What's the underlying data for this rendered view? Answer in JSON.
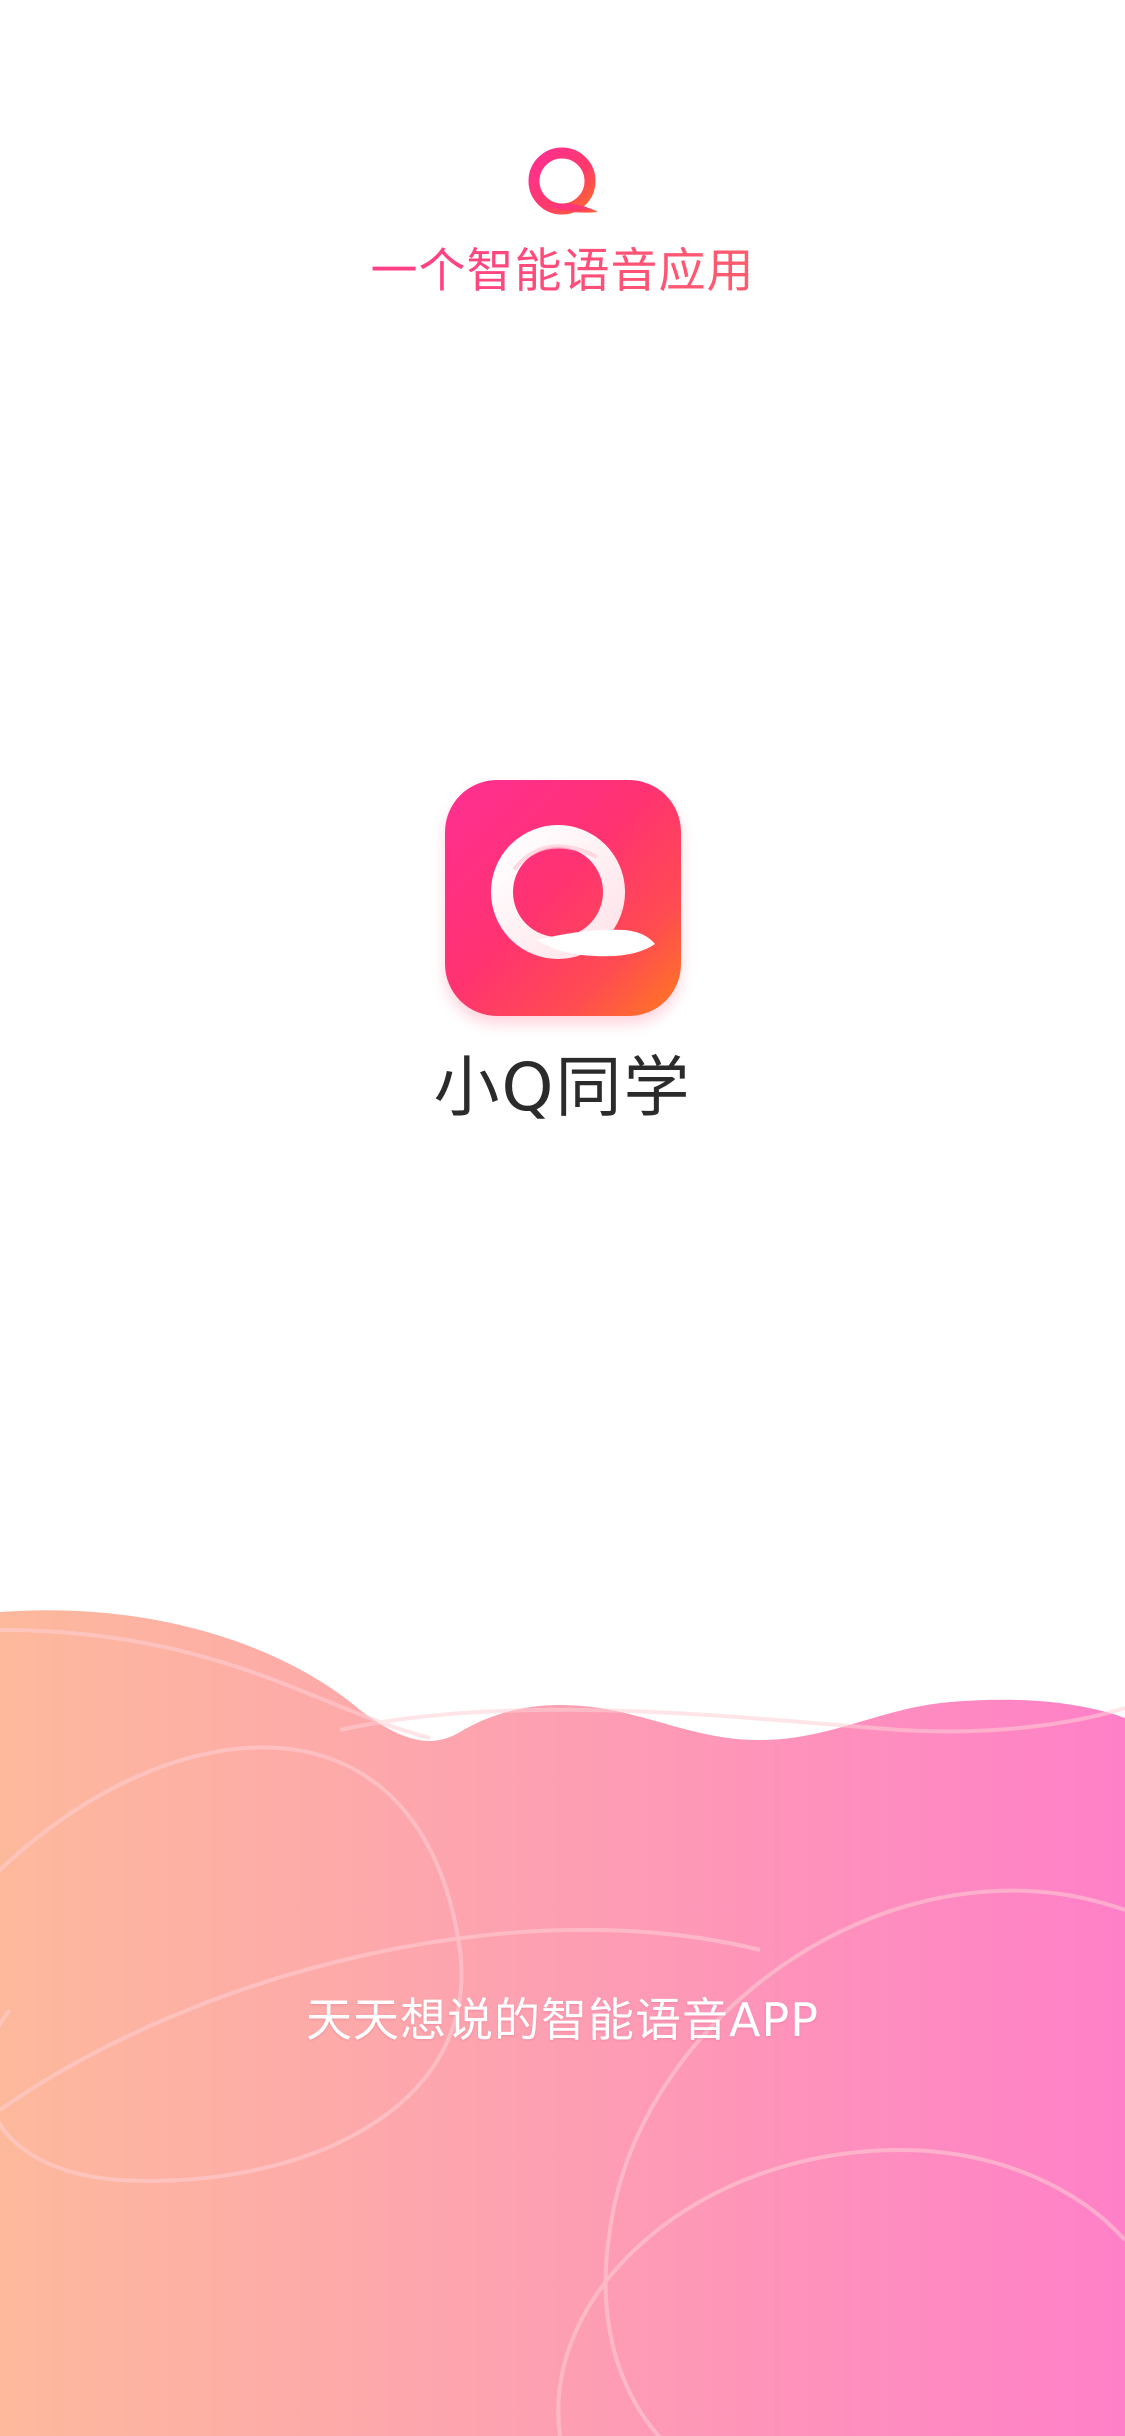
{
  "splash": {
    "tagline": "一个智能语音应用",
    "app_name": "小Q同学",
    "slogan": "天天想说的智能语音APP"
  },
  "icons": {
    "top_logo": "q-logo-icon",
    "app_icon": "app-q-icon"
  },
  "colors": {
    "brand_pink": "#ff2f93",
    "brand_red": "#ff3272",
    "brand_orange": "#ff7a1e",
    "wave_left": "#fdb99c",
    "wave_right": "#ff80c8",
    "app_name_text": "#2b2b2b",
    "background": "#ffffff"
  }
}
